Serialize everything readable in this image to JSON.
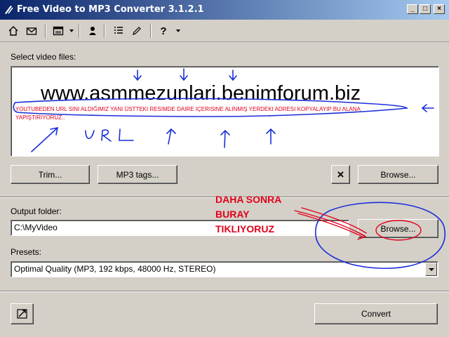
{
  "window": {
    "title": "Free Video to MP3 Converter 3.1.2.1"
  },
  "window_controls": {
    "minimize": "_",
    "maximize": "□",
    "close": "×"
  },
  "toolbar": {
    "icons": [
      "home-icon",
      "mail-icon",
      "window-list-icon",
      "user-icon",
      "list-icon",
      "pen-icon",
      "help-icon"
    ],
    "help_label": "?"
  },
  "input_section": {
    "label": "Select video files:",
    "trim_label": "Trim...",
    "tags_label": "MP3 tags...",
    "clear_label": "×",
    "browse_label": "Browse..."
  },
  "output_section": {
    "label": "Output folder:",
    "value": "C:\\MyVideo",
    "browse_label": "Browse..."
  },
  "presets_section": {
    "label": "Presets:",
    "selected": "Optimal Quality (MP3, 192 kbps, 48000 Hz, STEREO)"
  },
  "footer": {
    "convert_label": "Convert"
  },
  "annotations": {
    "watermark_url": "www.asmmezunlari.benimforum.biz",
    "note": "YOUTUBEDEN URL SINI ALDIĞIMIZ YANI ÜSTTEKI RESIMDE DAIRE IÇERISINE ALINMIŞ YERDEKI ADRESI KOPYALAYIP BU ALANA YAPIŞTIRIYORUZ..",
    "url_scribble": "URL",
    "line1": "DAHA SONRA",
    "line2": "BURAY",
    "line3": "TIKLIYORUZ",
    "ink_red": "#e2001a",
    "ink_blue": "#1a2fd8"
  }
}
